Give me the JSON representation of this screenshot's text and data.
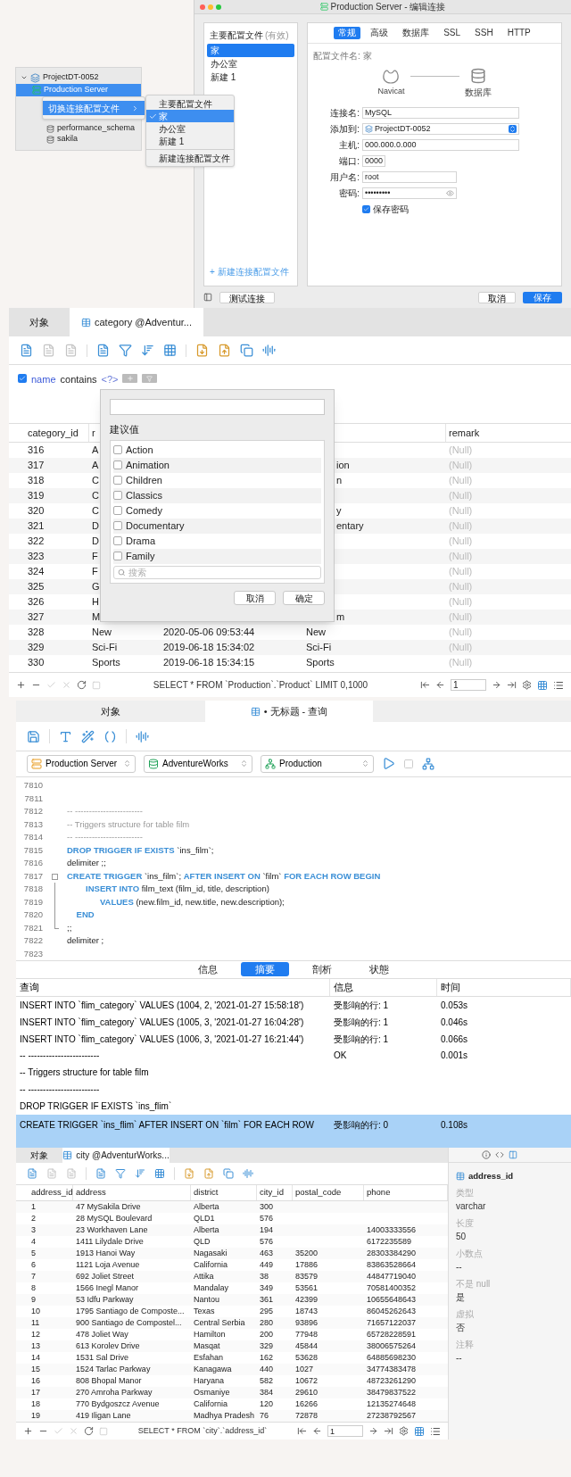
{
  "connection_tree": {
    "project": "ProjectDT-0052",
    "server": {
      "label": "Production Server",
      "selected": true
    },
    "databases": [
      "performance_schema",
      "sakila"
    ]
  },
  "context_menu": {
    "item": {
      "label": "切换连接配置文件",
      "selected": true
    }
  },
  "profile_submenu": {
    "items": [
      {
        "label": "主要配置文件",
        "checked": false
      },
      {
        "label": "家",
        "checked": true
      },
      {
        "label": "办公室",
        "checked": false
      },
      {
        "label": "新建 1",
        "checked": false
      }
    ],
    "footer": "新建连接配置文件"
  },
  "edit_dialog": {
    "title": "Production Server - 编辑连接",
    "profiles": {
      "header": "主要配置文件",
      "header_note": "(有效)",
      "items": [
        {
          "label": "家",
          "selected": true
        },
        {
          "label": "办公室",
          "selected": false
        },
        {
          "label": "新建 1",
          "selected": false
        }
      ],
      "new_link": "+ 新建连接配置文件"
    },
    "tabs": [
      {
        "label": "常规",
        "selected": true
      },
      {
        "label": "高级",
        "selected": false
      },
      {
        "label": "数据库",
        "selected": false
      },
      {
        "label": "SSL",
        "selected": false
      },
      {
        "label": "SSH",
        "selected": false
      },
      {
        "label": "HTTP",
        "selected": false
      }
    ],
    "profile_name": "配置文件名: 家",
    "diagram": {
      "left": "Navicat",
      "right": "数据库"
    },
    "fields": [
      {
        "label": "连接名:",
        "value": "MySQL",
        "kind": "text"
      },
      {
        "label": "添加到:",
        "value": "ProjectDT-0052",
        "kind": "select"
      },
      {
        "label": "主机:",
        "value": "000.000.0.000",
        "kind": "text"
      },
      {
        "label": "端口:",
        "value": "0000",
        "kind": "short"
      },
      {
        "label": "用户名:",
        "value": "root",
        "kind": "medium"
      },
      {
        "label": "密码:",
        "value": "•••••••••",
        "kind": "password"
      }
    ],
    "save_password": {
      "label": "保存密码",
      "checked": true
    },
    "buttons": {
      "test": "测试连接",
      "cancel": "取消",
      "save": "保存"
    }
  },
  "category_view": {
    "tabs": [
      {
        "label": "对象",
        "selected": false
      },
      {
        "label": "category @Adventur...",
        "selected": true
      }
    ],
    "filter": {
      "checked": true,
      "field": "name",
      "operator": "contains",
      "value": "<?>"
    },
    "columns": [
      "category_id",
      "r",
      null,
      null,
      "remark"
    ],
    "rows": [
      [
        "316",
        "A",
        null,
        null,
        "(Null)"
      ],
      [
        "317",
        "A",
        null,
        "ion",
        "(Null)"
      ],
      [
        "318",
        "C",
        null,
        "n",
        "(Null)"
      ],
      [
        "319",
        "C",
        null,
        null,
        "(Null)"
      ],
      [
        "320",
        "C",
        null,
        "y",
        "(Null)"
      ],
      [
        "321",
        "D",
        null,
        "entary",
        "(Null)"
      ],
      [
        "322",
        "D",
        null,
        null,
        "(Null)"
      ],
      [
        "323",
        "F",
        null,
        null,
        "(Null)"
      ],
      [
        "324",
        "F",
        null,
        null,
        "(Null)"
      ],
      [
        "325",
        "G",
        null,
        null,
        "(Null)"
      ],
      [
        "326",
        "H",
        null,
        null,
        "(Null)"
      ],
      [
        "327",
        "M",
        null,
        "m",
        "(Null)"
      ],
      [
        "328",
        "New",
        "2020-05-06 09:53:44",
        "New",
        "(Null)"
      ],
      [
        "329",
        "Sci-Fi",
        "2019-06-18 15:34:02",
        "Sci-Fi",
        "(Null)"
      ],
      [
        "330",
        "Sports",
        "2019-06-18 15:34:15",
        "Sports",
        "(Null)"
      ]
    ],
    "suggestions": {
      "title": "建议值",
      "options": [
        {
          "label": "Action",
          "checked": false
        },
        {
          "label": "Animation",
          "checked": false
        },
        {
          "label": "Children",
          "checked": false
        },
        {
          "label": "Classics",
          "checked": false
        },
        {
          "label": "Comedy",
          "checked": false
        },
        {
          "label": "Documentary",
          "checked": false
        },
        {
          "label": "Drama",
          "checked": false
        },
        {
          "label": "Family",
          "checked": false
        }
      ],
      "search_placeholder": "搜索",
      "cancel": "取消",
      "ok": "确定"
    },
    "status_sql": "SELECT * FROM `Production`.`Product` LIMIT 0,1000",
    "page": "1"
  },
  "query_view": {
    "tabs": [
      {
        "label": "对象",
        "selected": false
      },
      {
        "label": "• 无标题 - 查询",
        "selected": true
      }
    ],
    "selectors": [
      {
        "kind": "connection",
        "label": "Production Server"
      },
      {
        "kind": "database",
        "label": "AdventureWorks"
      },
      {
        "kind": "schema",
        "label": "Production"
      }
    ],
    "lines": [
      {
        "num": "7810",
        "kind": "plain"
      },
      {
        "num": "7811",
        "kind": "plain"
      },
      {
        "num": "7812",
        "kind": "plain",
        "tokens": [
          {
            "kind": "comment",
            "text": "-- ------------------------"
          }
        ]
      },
      {
        "num": "7813",
        "kind": "plain",
        "tokens": [
          {
            "kind": "comment",
            "text": "-- Triggers structure for table film"
          }
        ]
      },
      {
        "num": "7814",
        "kind": "plain",
        "tokens": [
          {
            "kind": "comment",
            "text": "-- ------------------------"
          }
        ]
      },
      {
        "num": "7815",
        "kind": "plain",
        "tokens": [
          {
            "kind": "keyword",
            "text": "DROP TRIGGER IF EXISTS"
          },
          {
            "kind": "text",
            "text": " `ins_film`;"
          }
        ]
      },
      {
        "num": "7816",
        "kind": "plain",
        "tokens": [
          {
            "kind": "text",
            "text": "delimiter ;;"
          }
        ]
      },
      {
        "num": "7817",
        "kind": "fold_start",
        "tokens": [
          {
            "kind": "keyword",
            "text": "CREATE TRIGGER"
          },
          {
            "kind": "text",
            "text": " `ins_film`; "
          },
          {
            "kind": "keyword",
            "text": "AFTER INSERT ON"
          },
          {
            "kind": "text",
            "text": " `film` "
          },
          {
            "kind": "keyword",
            "text": "FOR EACH ROW BEGIN"
          }
        ]
      },
      {
        "num": "7818",
        "kind": "fold_inside",
        "tokens": [
          {
            "kind": "keyword",
            "text": "        INSERT INTO"
          },
          {
            "kind": "text",
            "text": " film_text (film_id, title, description)"
          }
        ]
      },
      {
        "num": "7819",
        "kind": "fold_inside",
        "tokens": [
          {
            "kind": "keyword",
            "text": "              VALUES"
          },
          {
            "kind": "text",
            "text": " (new.film_id, new.title, new.description);"
          }
        ]
      },
      {
        "num": "7820",
        "kind": "fold_inside",
        "tokens": [
          {
            "kind": "keyword",
            "text": "    END"
          }
        ]
      },
      {
        "num": "7821",
        "kind": "fold_end",
        "tokens": [
          {
            "kind": "text",
            "text": ";;"
          }
        ]
      },
      {
        "num": "7822",
        "kind": "plain",
        "tokens": [
          {
            "kind": "text",
            "text": "delimiter ;"
          }
        ]
      },
      {
        "num": "7823",
        "kind": "plain"
      }
    ],
    "result_tabs": [
      {
        "label": "信息",
        "selected": false
      },
      {
        "label": "摘要",
        "selected": true
      },
      {
        "label": "剖析",
        "selected": false
      },
      {
        "label": "状態",
        "selected": false
      }
    ],
    "result_columns": [
      "查询",
      "信息",
      "时间"
    ],
    "results": [
      {
        "query": "INSERT INTO `flim_category` VALUES (1004, 2, '2021-01-27 15:58:18')",
        "info": "受影响的行: 1",
        "time": "0.053s",
        "selected": false
      },
      {
        "query": "INSERT INTO `flim_category` VALUES (1005, 3, '2021-01-27 16:04:28')",
        "info": "受影响的行: 1",
        "time": "0.046s",
        "selected": false
      },
      {
        "query": "INSERT INTO `flim_category` VALUES (1006, 3, '2021-01-27 16:21:44')",
        "info": "受影响的行: 1",
        "time": "0.066s",
        "selected": false
      },
      {
        "query": "-- ------------------------",
        "info": "OK",
        "time": "0.001s",
        "selected": false
      },
      {
        "query": "-- Triggers structure for table film",
        "selected": false
      },
      {
        "query": "-- ------------------------",
        "selected": false
      },
      {
        "query": "DROP TRIGGER IF EXISTS `ins_flim`",
        "selected": false
      },
      {
        "query": "CREATE TRIGGER `ins_flim` AFTER INSERT ON `film` FOR EACH ROW",
        "info": "受影响的行: 0",
        "time": "0.108s",
        "selected": true
      }
    ]
  },
  "city_view": {
    "tabs": [
      {
        "label": "对象",
        "selected": false
      },
      {
        "label": "city @AdventurWorks...",
        "selected": true
      }
    ],
    "columns": [
      "address_id",
      "address",
      "district",
      "city_id",
      "postal_code",
      "phone"
    ],
    "rows": [
      [
        "1",
        "47 MySakila Drive",
        "Alberta",
        "300",
        null,
        null
      ],
      [
        "2",
        "28 MySQL Boulevard",
        "QLD1",
        "576",
        null,
        null
      ],
      [
        "3",
        "23 Workhaven Lane",
        "Alberta",
        "194",
        null,
        "14003333556"
      ],
      [
        "4",
        "1411 Lilydale Drive",
        "QLD",
        "576",
        null,
        "6172235589"
      ],
      [
        "5",
        "1913 Hanoi Way",
        "Nagasaki",
        "463",
        "35200",
        "28303384290"
      ],
      [
        "6",
        "1121 Loja Avenue",
        "California",
        "449",
        "17886",
        "83863528664"
      ],
      [
        "7",
        "692 Joliet Street",
        "Attika",
        "38",
        "83579",
        "44847719040"
      ],
      [
        "8",
        "1566 Inegl Manor",
        "Mandalay",
        "349",
        "53561",
        "70581400352"
      ],
      [
        "9",
        "53 Idfu Parkway",
        "Nantou",
        "361",
        "42399",
        "10655648643"
      ],
      [
        "10",
        "1795 Santiago de Composte...",
        "Texas",
        "295",
        "18743",
        "86045262643"
      ],
      [
        "11",
        "900 Santiago de Compostel...",
        "Central Serbia",
        "280",
        "93896",
        "71657122037"
      ],
      [
        "12",
        "478 Joliet Way",
        "Hamilton",
        "200",
        "77948",
        "65728228591"
      ],
      [
        "13",
        "613 Korolev Drive",
        "Masqat",
        "329",
        "45844",
        "38006575264"
      ],
      [
        "14",
        "1531 Sal Drive",
        "Esfahan",
        "162",
        "53628",
        "64885698230"
      ],
      [
        "15",
        "1524 Tarlac Parkway",
        "Kanagawa",
        "440",
        "1027",
        "34774383478"
      ],
      [
        "16",
        "808 Bhopal Manor",
        "Haryana",
        "582",
        "10672",
        "48723261290"
      ],
      [
        "17",
        "270 Amroha Parkway",
        "Osmaniye",
        "384",
        "29610",
        "38479837522"
      ],
      [
        "18",
        "770 Bydgoszcz Avenue",
        "California",
        "120",
        "16266",
        "12135274648"
      ],
      [
        "19",
        "419 Iligan Lane",
        "Madhya Pradesh",
        "76",
        "72878",
        "27238792567"
      ]
    ],
    "status_sql": "SELECT * FROM `city`.`address_id`",
    "page": "1",
    "field_panel": {
      "title": "address_id",
      "properties": [
        {
          "label": "类型",
          "value": "varchar"
        },
        {
          "label": "长度",
          "value": "50"
        },
        {
          "label": "小数点",
          "value": "--"
        },
        {
          "label": "不是 null",
          "value": "是"
        },
        {
          "label": "虚拟",
          "value": "否"
        },
        {
          "label": "注释",
          "value": "--"
        }
      ]
    }
  }
}
